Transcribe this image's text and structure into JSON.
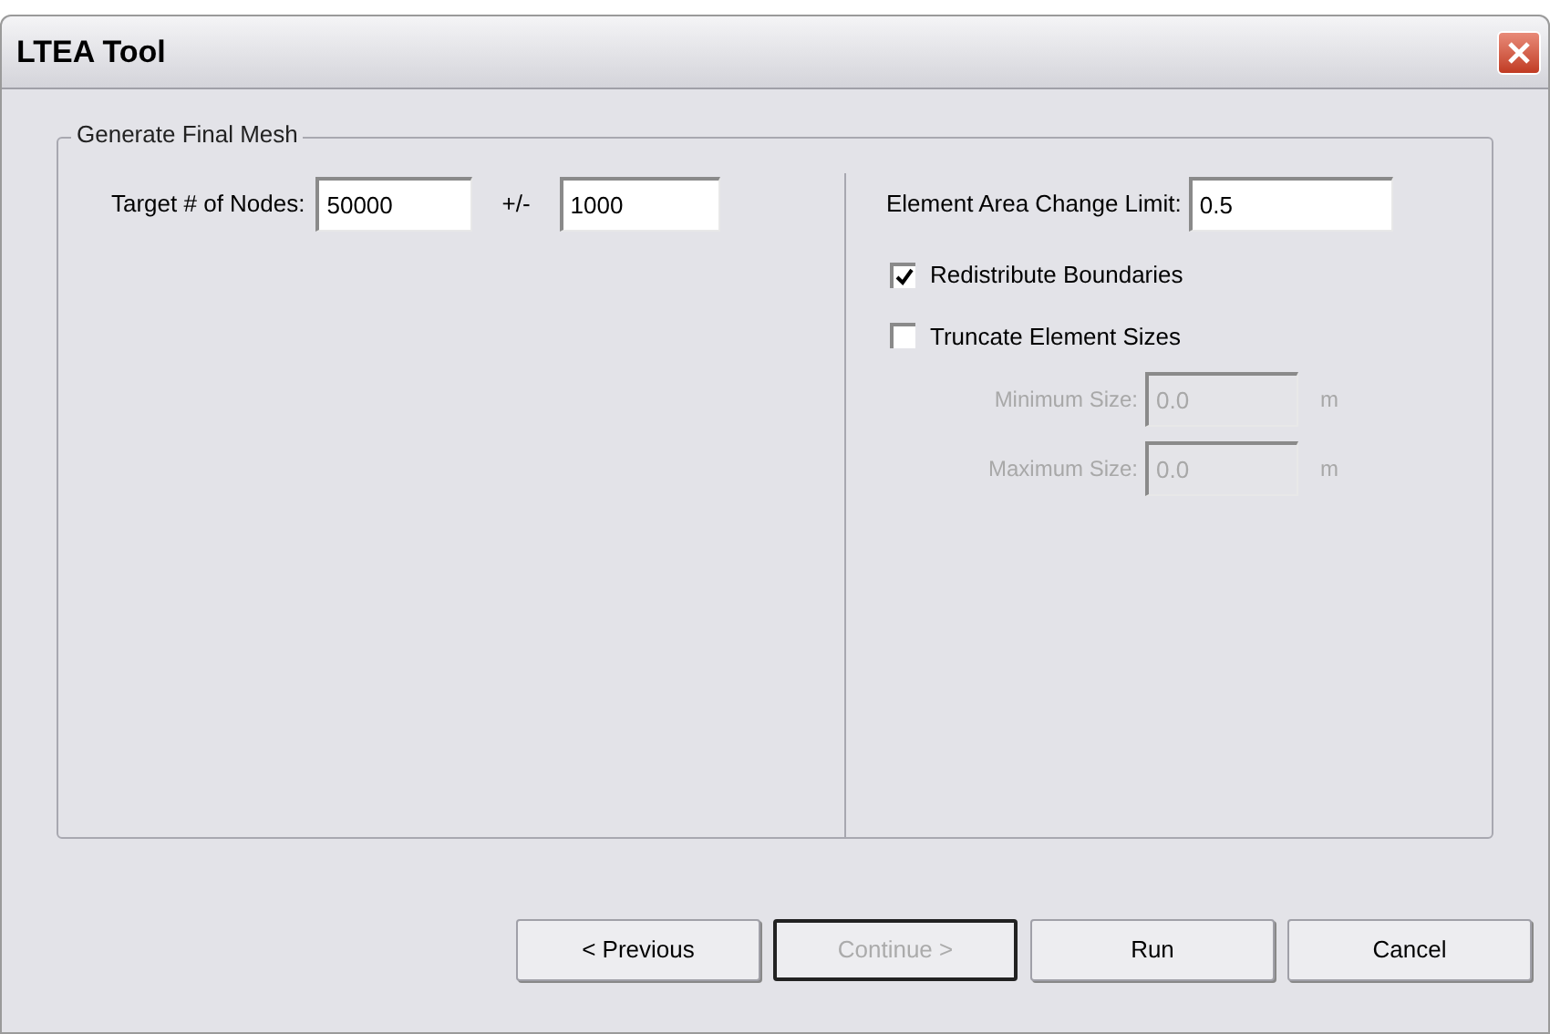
{
  "window": {
    "title": "LTEA Tool"
  },
  "group": {
    "title": "Generate Final Mesh"
  },
  "nodes": {
    "label": "Target # of Nodes:",
    "value": "50000",
    "tolerance_label": "+/-",
    "tolerance_value": "1000"
  },
  "area_limit": {
    "label": "Element Area Change Limit:",
    "value": "0.5"
  },
  "checkboxes": [
    {
      "label": "Redistribute Boundaries",
      "checked": true
    },
    {
      "label": "Truncate Element Sizes",
      "checked": false
    }
  ],
  "size_fields": [
    {
      "label": "Minimum Size:",
      "value": "0.0",
      "unit": "m",
      "disabled": true
    },
    {
      "label": "Maximum Size:",
      "value": "0.0",
      "unit": "m",
      "disabled": true
    }
  ],
  "buttons": [
    {
      "label": "< Previous",
      "disabled": false,
      "focused": false
    },
    {
      "label": "Continue >",
      "disabled": true,
      "focused": true
    },
    {
      "label": "Run",
      "disabled": false,
      "focused": false
    },
    {
      "label": "Cancel",
      "disabled": false,
      "focused": false
    }
  ]
}
